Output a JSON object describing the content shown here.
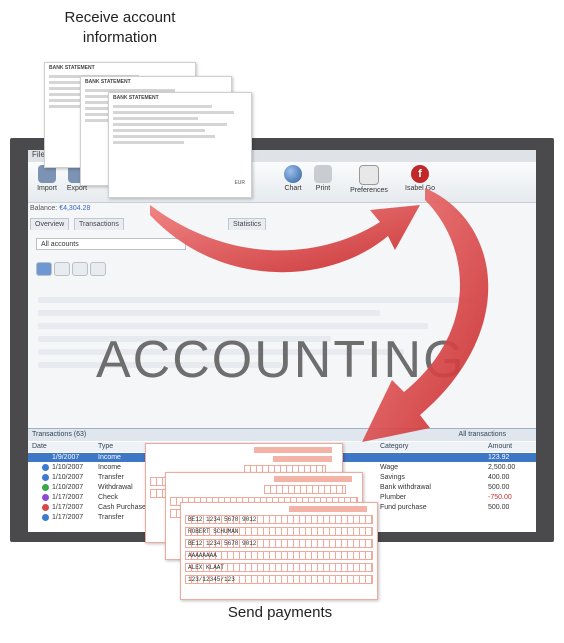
{
  "captions": {
    "top": "Receive account information",
    "bottom": "Send payments"
  },
  "app": {
    "title": "File",
    "toolbar": [
      "Import",
      "Export",
      "Chart",
      "Print",
      "Preferences",
      "Isabel Go"
    ],
    "balance_label": "Balance:",
    "balance_value": "€4,304.28",
    "tabs": [
      "Overview",
      "Transactions",
      "Statistics"
    ],
    "filter": "All accounts",
    "watermark": "ACCOUNTING",
    "tx_title": "Transactions (63)",
    "tx_all": "All transactions",
    "columns": [
      "Date",
      "Type",
      "Category",
      "Amount"
    ],
    "rows": [
      {
        "date": "1/9/2007",
        "type": "Income",
        "category": "",
        "amount": "123.92",
        "color": "#3d77c6",
        "selected": true
      },
      {
        "date": "1/10/2007",
        "type": "Income",
        "category": "Wage",
        "amount": "2,500.00",
        "color": "#3a7ad1"
      },
      {
        "date": "1/10/2007",
        "type": "Transfer",
        "category": "Savings",
        "amount": "400.00",
        "color": "#3a7ad1"
      },
      {
        "date": "1/10/2007",
        "type": "Withdrawal",
        "category": "Bank withdrawal",
        "amount": "500.00",
        "color": "#3aa84a"
      },
      {
        "date": "1/17/2007",
        "type": "Check",
        "category": "Plumber",
        "amount": "-750.00",
        "color": "#8a4bd2"
      },
      {
        "date": "1/17/2007",
        "type": "Cash Purchase",
        "category": "Fund purchase",
        "amount": "500.00",
        "color": "#d24b4b"
      },
      {
        "date": "1/17/2007",
        "type": "Transfer",
        "category": "",
        "amount": "",
        "color": "#3a7ad1"
      }
    ]
  },
  "statement": {
    "heading": "BANK STATEMENT",
    "currency": "EUR"
  },
  "forms": [
    {
      "line1": "BE12 1234 5678 9012",
      "line2": "ROBERT SCHUMAN",
      "line3": "",
      "line4": ""
    },
    {
      "line1": "BE12 1234 5678 9012",
      "line2": "AAAAAAAA",
      "line3": "ALEX KLAAT",
      "line4": "123/12345/123"
    }
  ],
  "colors": {
    "accent_red": "#d9393b",
    "monitor": "#4a4a4c",
    "selection_blue": "#3d77c6"
  }
}
